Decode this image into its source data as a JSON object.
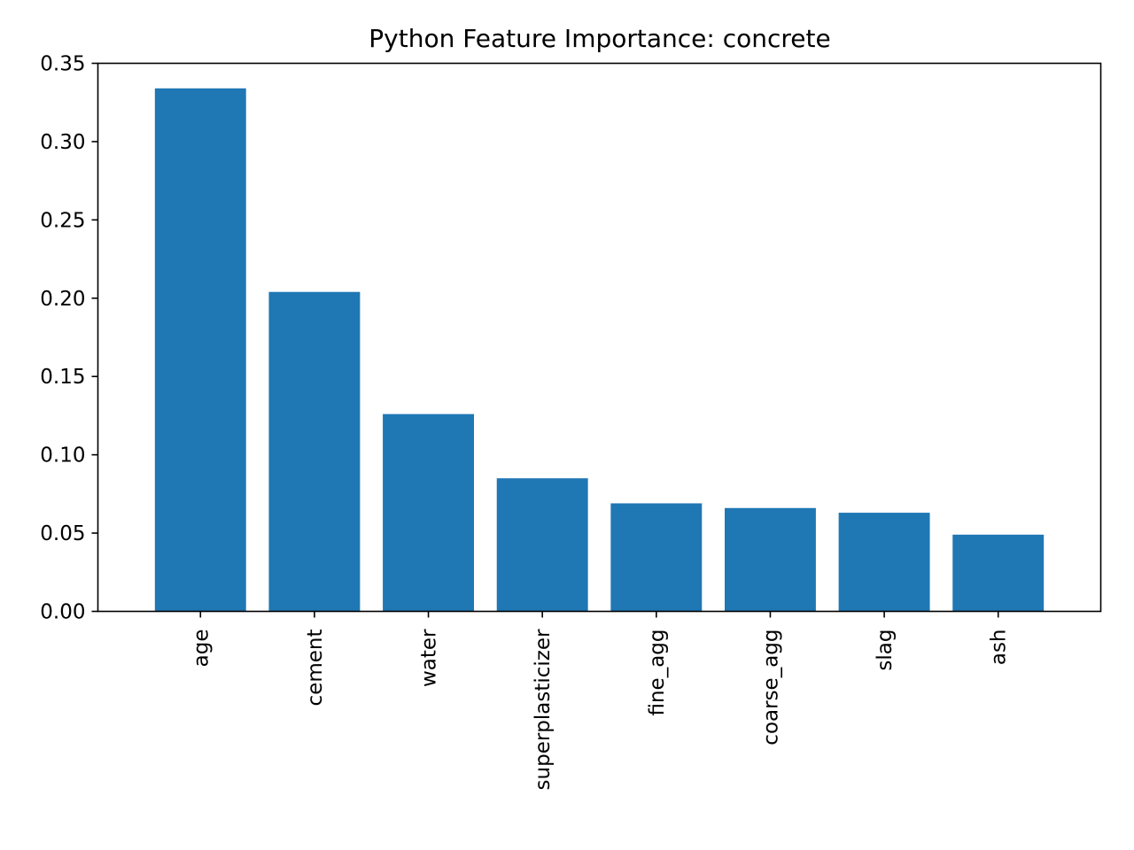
{
  "chart_data": {
    "type": "bar",
    "title": "Python Feature Importance: concrete",
    "xlabel": "",
    "ylabel": "",
    "categories": [
      "age",
      "cement",
      "water",
      "superplasticizer",
      "fine_agg",
      "coarse_agg",
      "slag",
      "ash"
    ],
    "values": [
      0.334,
      0.204,
      0.126,
      0.085,
      0.069,
      0.066,
      0.063,
      0.049
    ],
    "ylim": [
      0,
      0.35
    ],
    "yticks": [
      0.0,
      0.05,
      0.1,
      0.15,
      0.2,
      0.25,
      0.3,
      0.35
    ],
    "ytick_labels": [
      "0.00",
      "0.05",
      "0.10",
      "0.15",
      "0.20",
      "0.25",
      "0.30",
      "0.35"
    ],
    "bar_color": "#1f77b4",
    "grid": false,
    "legend": "none",
    "xtick_rotation": "vertical"
  }
}
